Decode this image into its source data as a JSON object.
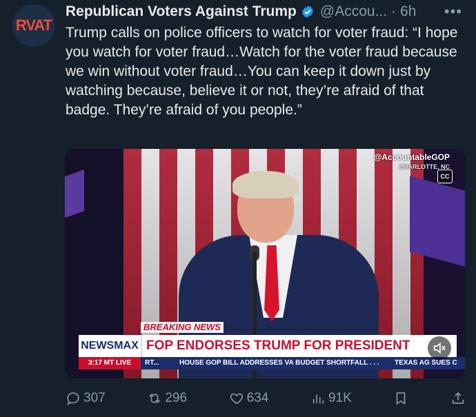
{
  "author": {
    "avatar_text": "RVAT",
    "name": "Republican Voters Against Trump",
    "handle": "@Accou...",
    "time": "6h",
    "separator": "·",
    "more": "•••"
  },
  "tweet_text": "Trump calls on police officers to watch for voter fraud: “I hope you watch for voter fraud…Watch for the voter fraud because we win without voter fraud…You can keep it down just by watching because, believe it or not, they’re afraid of that badge. They’re afraid of you people.”",
  "video": {
    "watermark": "@AccountableGOP",
    "location": "CHARLOTTE, NC",
    "cc_label": "CC",
    "breaking": "BREAKING NEWS",
    "network": "NEWSMAX",
    "headline": "FOP ENDORSES TRUMP FOR PRESIDENT",
    "ticker_time": "3:17 MT  LIVE",
    "ticker_items": [
      "RT...",
      "HOUSE GOP BILL ADDRESSES VA BUDGET SHORTFALL . . .",
      "TEXAS AG SUES C"
    ]
  },
  "actions": {
    "replies": "307",
    "reposts": "296",
    "likes": "634",
    "views": "91K"
  },
  "colors": {
    "background": "#15202b",
    "text": "#e7e9ea",
    "muted": "#8b98a5",
    "verified": "#1d9bf0"
  }
}
